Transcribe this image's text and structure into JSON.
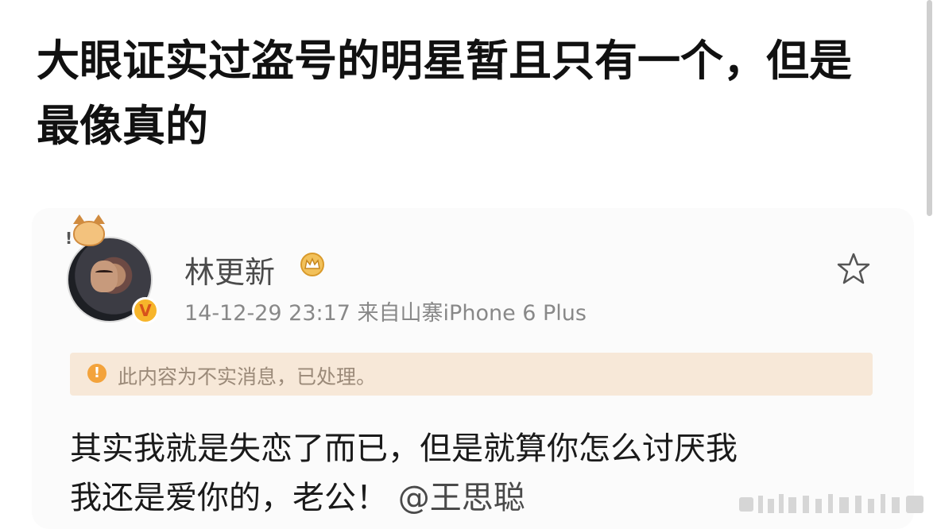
{
  "headline": "大眼证实过盗号的明星暂且只有一个，但是最像真的",
  "post": {
    "username": "林更新",
    "timestamp": "14-12-29 23:17",
    "source": "来自山寨iPhone 6 Plus",
    "notice": "此内容为不实消息，已处理。",
    "content_line1": "其实我就是失恋了而已，但是就算你怎么讨厌我",
    "content_line2_text": "我还是爱你的，老公！",
    "mention": "@王思聪"
  },
  "icons": {
    "crown": "crown-icon",
    "star": "star-outline-icon",
    "warning": "warning-icon",
    "verified": "verified-v-icon"
  },
  "colors": {
    "notice_bg": "#f7e8d8",
    "notice_text": "#9b8a79",
    "badge_orange": "#f7b52b"
  }
}
